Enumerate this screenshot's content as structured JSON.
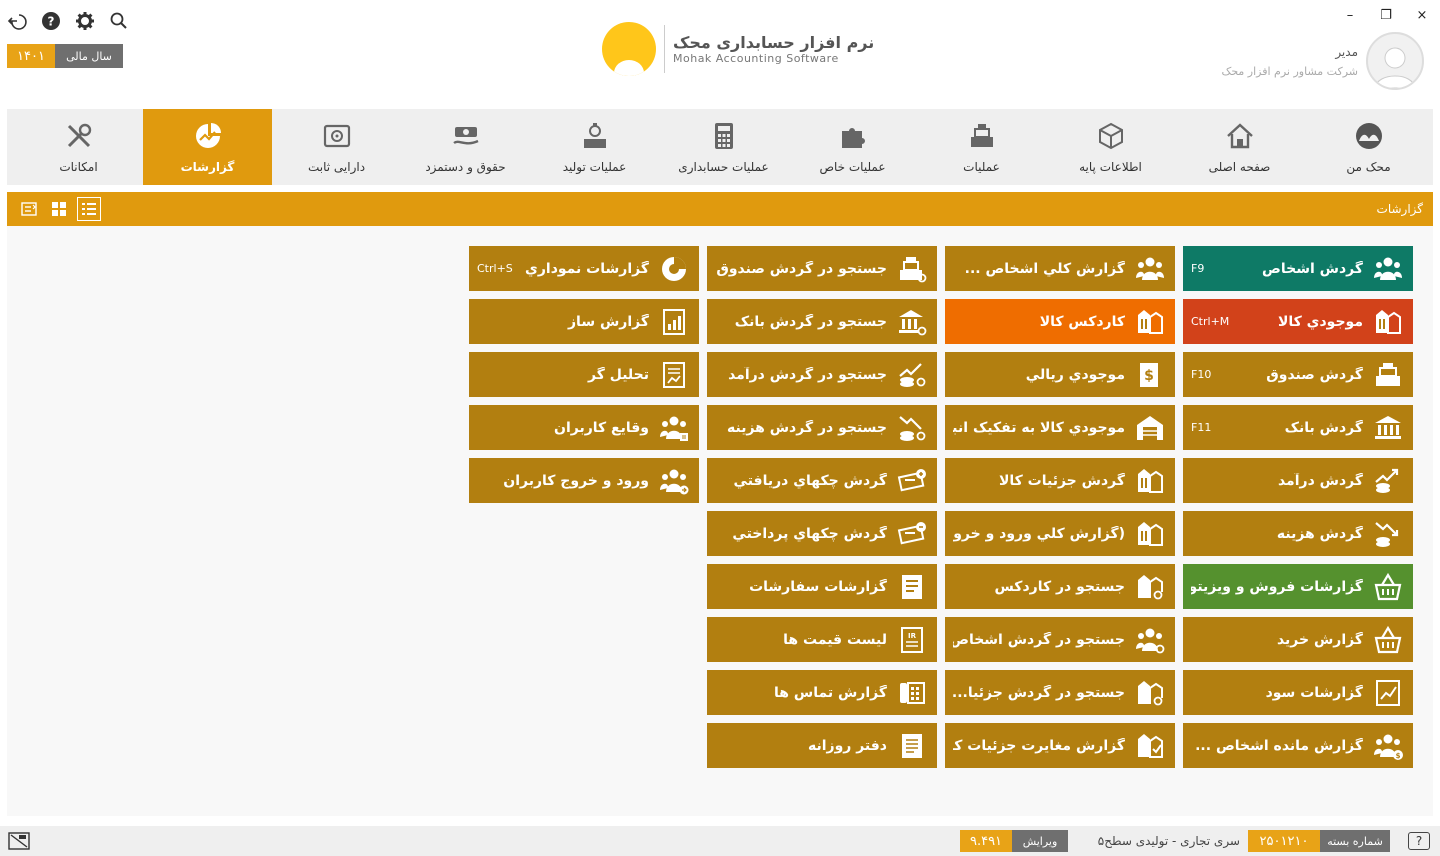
{
  "window": {
    "controls": [
      "×",
      "❐",
      "–"
    ]
  },
  "fiscal": {
    "label": "سال مالی",
    "year": "۱۴۰۱"
  },
  "logo": {
    "title_fa": "نرم افزار حسابداری محک",
    "title_en": "Mohak Accounting Software"
  },
  "user": {
    "name": "مدیر",
    "company": "شرکت مشاور نرم افزار محک"
  },
  "nav": {
    "items": [
      {
        "label": "محک من",
        "icon": "mohak-icon"
      },
      {
        "label": "صفحه اصلی",
        "icon": "home-icon"
      },
      {
        "label": "اطلاعات پایه",
        "icon": "cube-icon"
      },
      {
        "label": "عملیات",
        "icon": "register-icon"
      },
      {
        "label": "عملیات خاص",
        "icon": "puzzle-icon"
      },
      {
        "label": "عملیات حسابداری",
        "icon": "calculator-icon"
      },
      {
        "label": "عملیات تولید",
        "icon": "factory-icon"
      },
      {
        "label": "حقوق و دستمزد",
        "icon": "salary-icon"
      },
      {
        "label": "دارایی ثابت",
        "icon": "safe-icon"
      },
      {
        "label": "گزارشات",
        "icon": "reports-icon"
      },
      {
        "label": "امکانات",
        "icon": "tools-icon"
      }
    ],
    "active_index": 9
  },
  "section": {
    "title": "گزارشات"
  },
  "tiles": {
    "col1": [
      {
        "label": "گردش اشخاص",
        "shortcut": "F9",
        "icon": "people-icon",
        "color": "teal"
      },
      {
        "label": "موجودي کالا",
        "shortcut": "Ctrl+M",
        "icon": "inventory-icon",
        "color": "red"
      },
      {
        "label": "گردش صندوق",
        "shortcut": "F10",
        "icon": "cash-register-icon",
        "color": ""
      },
      {
        "label": "گردش بانک",
        "shortcut": "F11",
        "icon": "bank-icon",
        "color": ""
      },
      {
        "label": "گردش درآمد",
        "shortcut": "",
        "icon": "income-icon",
        "color": ""
      },
      {
        "label": "گردش هزينه",
        "shortcut": "",
        "icon": "expense-icon",
        "color": ""
      },
      {
        "label": "گزارشات فروش و ويزيتوري",
        "shortcut": "",
        "icon": "basket-icon",
        "color": "green"
      },
      {
        "label": "گزارش خريد",
        "shortcut": "",
        "icon": "basket-icon",
        "color": ""
      },
      {
        "label": "گزارشات سود",
        "shortcut": "",
        "icon": "profit-chart-icon",
        "color": ""
      },
      {
        "label": "گزارش مانده اشخاص ...",
        "shortcut": "",
        "icon": "people-balance-icon",
        "color": ""
      }
    ],
    "col2": [
      {
        "label": "گزارش کلي اشخاص ...",
        "shortcut": "",
        "icon": "people-icon",
        "color": ""
      },
      {
        "label": "کاردکس کالا",
        "shortcut": "",
        "icon": "inventory-icon",
        "color": "orange"
      },
      {
        "label": "موجودي ريالي",
        "shortcut": "",
        "icon": "money-doc-icon",
        "color": ""
      },
      {
        "label": "موجودي کالا به تفکيک انبار",
        "shortcut": "",
        "icon": "warehouse-icon",
        "color": ""
      },
      {
        "label": "گردش جزئيات کالا",
        "shortcut": "",
        "icon": "inventory-icon",
        "color": ""
      },
      {
        "label": "(گزارش کلي ورود و خرو...",
        "shortcut": "",
        "icon": "inventory-icon",
        "color": ""
      },
      {
        "label": "جستجو در کاردکس",
        "shortcut": "",
        "icon": "inventory-search-icon",
        "color": ""
      },
      {
        "label": "جستجو در گردش اشخاص",
        "shortcut": "",
        "icon": "people-search-icon",
        "color": ""
      },
      {
        "label": "جستجو در گردش جزئيا...",
        "shortcut": "",
        "icon": "inventory-search-icon",
        "color": ""
      },
      {
        "label": "گزارش مغايرت جزئيات کالا",
        "shortcut": "",
        "icon": "inventory-check-icon",
        "color": ""
      }
    ],
    "col3": [
      {
        "label": "جستجو در گردش صندوق",
        "shortcut": "",
        "icon": "cash-search-icon",
        "color": ""
      },
      {
        "label": "جستجو در گردش بانک",
        "shortcut": "",
        "icon": "bank-search-icon",
        "color": ""
      },
      {
        "label": "جستجو در گردش درآمد",
        "shortcut": "",
        "icon": "income-search-icon",
        "color": ""
      },
      {
        "label": "جستجو در گردش هزينه",
        "shortcut": "",
        "icon": "expense-search-icon",
        "color": ""
      },
      {
        "label": "گردش چکهاي دريافتي",
        "shortcut": "",
        "icon": "cheque-in-icon",
        "color": ""
      },
      {
        "label": "گردش چکهاي پرداختي",
        "shortcut": "",
        "icon": "cheque-out-icon",
        "color": ""
      },
      {
        "label": "گزارشات سفارشات",
        "shortcut": "",
        "icon": "orders-icon",
        "color": ""
      },
      {
        "label": "ليست قيمت ها",
        "shortcut": "",
        "icon": "price-list-icon",
        "color": ""
      },
      {
        "label": "گزارش تماس ها",
        "shortcut": "",
        "icon": "phone-icon",
        "color": ""
      },
      {
        "label": "دفتر روزانه",
        "shortcut": "",
        "icon": "journal-icon",
        "color": ""
      }
    ],
    "col4": [
      {
        "label": "گزارشات نموداري",
        "shortcut": "Ctrl+S",
        "icon": "pie-chart-icon",
        "color": ""
      },
      {
        "label": "گزارش ساز",
        "shortcut": "",
        "icon": "report-builder-icon",
        "color": ""
      },
      {
        "label": "تحليل گر",
        "shortcut": "",
        "icon": "analyzer-icon",
        "color": ""
      },
      {
        "label": "وقايع کاربران",
        "shortcut": "",
        "icon": "users-events-icon",
        "color": ""
      },
      {
        "label": "ورود و خروج کاربران",
        "shortcut": "",
        "icon": "users-login-icon",
        "color": ""
      }
    ]
  },
  "colors": {
    "accent": "#e09a0e",
    "tile": "#b27f10",
    "teal": "#0e7a66",
    "red": "#d2421a",
    "orange": "#ef6d00",
    "green": "#55912e"
  },
  "status": {
    "help": "?",
    "package_label": "شماره بسته",
    "package_value": "۲۵۰۱۲۱۰",
    "series": "سری تجاری - تولیدی سطح۵",
    "version_label": "ویرایش",
    "version_value": "۹.۴۹۱"
  }
}
